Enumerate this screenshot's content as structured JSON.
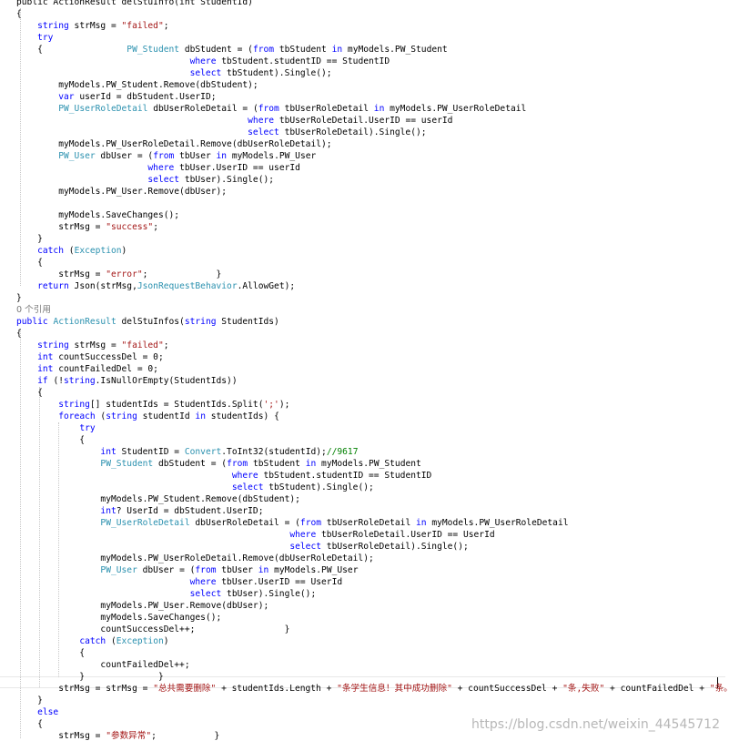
{
  "watermark": "https://blog.csdn.net/weixin_44545712",
  "code_lines": [
    [
      [
        "p",
        "public ActionResult delStuInfo(int StudentId)"
      ]
    ],
    [
      [
        "p",
        "{"
      ]
    ],
    [
      [
        "p",
        "    "
      ],
      [
        "kw",
        "string"
      ],
      [
        "p",
        " strMsg = "
      ],
      [
        "st",
        "\"failed\""
      ],
      [
        "p",
        ";"
      ]
    ],
    [
      [
        "p",
        "    "
      ],
      [
        "kw",
        "try"
      ]
    ],
    [
      [
        "p",
        "    {                "
      ],
      [
        "ty",
        "PW_Student"
      ],
      [
        "p",
        " dbStudent = ("
      ],
      [
        "kw",
        "from"
      ],
      [
        "p",
        " tbStudent "
      ],
      [
        "kw",
        "in"
      ],
      [
        "p",
        " myModels.PW_Student"
      ]
    ],
    [
      [
        "p",
        "                                 "
      ],
      [
        "kw",
        "where"
      ],
      [
        "p",
        " tbStudent.studentID == StudentID"
      ]
    ],
    [
      [
        "p",
        "                                 "
      ],
      [
        "kw",
        "select"
      ],
      [
        "p",
        " tbStudent).Single();"
      ]
    ],
    [
      [
        "p",
        "        myModels.PW_Student.Remove(dbStudent);"
      ]
    ],
    [
      [
        "p",
        "        "
      ],
      [
        "kw",
        "var"
      ],
      [
        "p",
        " userId = dbStudent.UserID;"
      ]
    ],
    [
      [
        "p",
        "        "
      ],
      [
        "ty",
        "PW_UserRoleDetail"
      ],
      [
        "p",
        " dbUserRoleDetail = ("
      ],
      [
        "kw",
        "from"
      ],
      [
        "p",
        " tbUserRoleDetail "
      ],
      [
        "kw",
        "in"
      ],
      [
        "p",
        " myModels.PW_UserRoleDetail"
      ]
    ],
    [
      [
        "p",
        "                                            "
      ],
      [
        "kw",
        "where"
      ],
      [
        "p",
        " tbUserRoleDetail.UserID == userId"
      ]
    ],
    [
      [
        "p",
        "                                            "
      ],
      [
        "kw",
        "select"
      ],
      [
        "p",
        " tbUserRoleDetail).Single();"
      ]
    ],
    [
      [
        "p",
        "        myModels.PW_UserRoleDetail.Remove(dbUserRoleDetail);"
      ]
    ],
    [
      [
        "p",
        "        "
      ],
      [
        "ty",
        "PW_User"
      ],
      [
        "p",
        " dbUser = ("
      ],
      [
        "kw",
        "from"
      ],
      [
        "p",
        " tbUser "
      ],
      [
        "kw",
        "in"
      ],
      [
        "p",
        " myModels.PW_User"
      ]
    ],
    [
      [
        "p",
        "                         "
      ],
      [
        "kw",
        "where"
      ],
      [
        "p",
        " tbUser.UserID == userId"
      ]
    ],
    [
      [
        "p",
        "                         "
      ],
      [
        "kw",
        "select"
      ],
      [
        "p",
        " tbUser).Single();"
      ]
    ],
    [
      [
        "p",
        "        myModels.PW_User.Remove(dbUser);"
      ]
    ],
    [
      [
        "p",
        ""
      ]
    ],
    [
      [
        "p",
        "        myModels.SaveChanges();"
      ]
    ],
    [
      [
        "p",
        "        strMsg = "
      ],
      [
        "st",
        "\"success\""
      ],
      [
        "p",
        ";"
      ]
    ],
    [
      [
        "p",
        "    }"
      ]
    ],
    [
      [
        "p",
        "    "
      ],
      [
        "kw",
        "catch"
      ],
      [
        "p",
        " ("
      ],
      [
        "ty",
        "Exception"
      ],
      [
        "p",
        ")"
      ]
    ],
    [
      [
        "p",
        "    {"
      ]
    ],
    [
      [
        "p",
        "        strMsg = "
      ],
      [
        "st",
        "\"error\""
      ],
      [
        "p",
        ";             }"
      ]
    ],
    [
      [
        "p",
        "    "
      ],
      [
        "kw",
        "return"
      ],
      [
        "p",
        " Json(strMsg,"
      ],
      [
        "ty",
        "JsonRequestBehavior"
      ],
      [
        "p",
        ".AllowGet);"
      ]
    ],
    [
      [
        "p",
        "}"
      ]
    ],
    [
      [
        "lens",
        "0 个引用"
      ]
    ],
    [
      [
        "kw",
        "public"
      ],
      [
        "p",
        " "
      ],
      [
        "ty",
        "ActionResult"
      ],
      [
        "p",
        " delStuInfos("
      ],
      [
        "kw",
        "string"
      ],
      [
        "p",
        " StudentIds)"
      ]
    ],
    [
      [
        "p",
        "{"
      ]
    ],
    [
      [
        "p",
        "    "
      ],
      [
        "kw",
        "string"
      ],
      [
        "p",
        " strMsg = "
      ],
      [
        "st",
        "\"failed\""
      ],
      [
        "p",
        ";"
      ]
    ],
    [
      [
        "p",
        "    "
      ],
      [
        "kw",
        "int"
      ],
      [
        "p",
        " countSuccessDel = 0;"
      ]
    ],
    [
      [
        "p",
        "    "
      ],
      [
        "kw",
        "int"
      ],
      [
        "p",
        " countFailedDel = 0;"
      ]
    ],
    [
      [
        "p",
        "    "
      ],
      [
        "kw",
        "if"
      ],
      [
        "p",
        " (!"
      ],
      [
        "kw",
        "string"
      ],
      [
        "p",
        ".IsNullOrEmpty(StudentIds))"
      ]
    ],
    [
      [
        "p",
        "    {"
      ]
    ],
    [
      [
        "p",
        "        "
      ],
      [
        "kw",
        "string"
      ],
      [
        "p",
        "[] studentIds = StudentIds.Split("
      ],
      [
        "st",
        "';'"
      ],
      [
        "p",
        ");"
      ]
    ],
    [
      [
        "p",
        "        "
      ],
      [
        "kw",
        "foreach"
      ],
      [
        "p",
        " ("
      ],
      [
        "kw",
        "string"
      ],
      [
        "p",
        " studentId "
      ],
      [
        "kw",
        "in"
      ],
      [
        "p",
        " studentIds) {"
      ]
    ],
    [
      [
        "p",
        "            "
      ],
      [
        "kw",
        "try"
      ]
    ],
    [
      [
        "p",
        "            {"
      ]
    ],
    [
      [
        "p",
        "                "
      ],
      [
        "kw",
        "int"
      ],
      [
        "p",
        " StudentID = "
      ],
      [
        "ty",
        "Convert"
      ],
      [
        "p",
        ".ToInt32(studentId);"
      ],
      [
        "cm",
        "//9617"
      ]
    ],
    [
      [
        "p",
        "                "
      ],
      [
        "ty",
        "PW_Student"
      ],
      [
        "p",
        " dbStudent = ("
      ],
      [
        "kw",
        "from"
      ],
      [
        "p",
        " tbStudent "
      ],
      [
        "kw",
        "in"
      ],
      [
        "p",
        " myModels.PW_Student"
      ]
    ],
    [
      [
        "p",
        "                                         "
      ],
      [
        "kw",
        "where"
      ],
      [
        "p",
        " tbStudent.studentID == StudentID"
      ]
    ],
    [
      [
        "p",
        "                                         "
      ],
      [
        "kw",
        "select"
      ],
      [
        "p",
        " tbStudent).Single();"
      ]
    ],
    [
      [
        "p",
        "                myModels.PW_Student.Remove(dbStudent);"
      ]
    ],
    [
      [
        "p",
        "                "
      ],
      [
        "kw",
        "int"
      ],
      [
        "p",
        "? UserId = dbStudent.UserID;"
      ]
    ],
    [
      [
        "p",
        "                "
      ],
      [
        "ty",
        "PW_UserRoleDetail"
      ],
      [
        "p",
        " dbUserRoleDetail = ("
      ],
      [
        "kw",
        "from"
      ],
      [
        "p",
        " tbUserRoleDetail "
      ],
      [
        "kw",
        "in"
      ],
      [
        "p",
        " myModels.PW_UserRoleDetail"
      ]
    ],
    [
      [
        "p",
        "                                                    "
      ],
      [
        "kw",
        "where"
      ],
      [
        "p",
        " tbUserRoleDetail.UserID == UserId"
      ]
    ],
    [
      [
        "p",
        "                                                    "
      ],
      [
        "kw",
        "select"
      ],
      [
        "p",
        " tbUserRoleDetail).Single();"
      ]
    ],
    [
      [
        "p",
        "                myModels.PW_UserRoleDetail.Remove(dbUserRoleDetail);"
      ]
    ],
    [
      [
        "p",
        "                "
      ],
      [
        "ty",
        "PW_User"
      ],
      [
        "p",
        " dbUser = ("
      ],
      [
        "kw",
        "from"
      ],
      [
        "p",
        " tbUser "
      ],
      [
        "kw",
        "in"
      ],
      [
        "p",
        " myModels.PW_User"
      ]
    ],
    [
      [
        "p",
        "                                 "
      ],
      [
        "kw",
        "where"
      ],
      [
        "p",
        " tbUser.UserID == UserId"
      ]
    ],
    [
      [
        "p",
        "                                 "
      ],
      [
        "kw",
        "select"
      ],
      [
        "p",
        " tbUser).Single();"
      ]
    ],
    [
      [
        "p",
        "                myModels.PW_User.Remove(dbUser);"
      ]
    ],
    [
      [
        "p",
        "                myModels.SaveChanges();"
      ]
    ],
    [
      [
        "p",
        "                countSuccessDel++;                 }"
      ]
    ],
    [
      [
        "p",
        "            "
      ],
      [
        "kw",
        "catch"
      ],
      [
        "p",
        " ("
      ],
      [
        "ty",
        "Exception"
      ],
      [
        "p",
        ")"
      ]
    ],
    [
      [
        "p",
        "            {"
      ]
    ],
    [
      [
        "p",
        "                countFailedDel++;"
      ]
    ],
    [
      [
        "p",
        "            }              }"
      ]
    ],
    [
      [
        "p",
        "        strMsg = strMsg = "
      ],
      [
        "st",
        "\"总共需要删除\""
      ],
      [
        "p",
        " + studentIds.Length + "
      ],
      [
        "st",
        "\"条学生信息！其中成功删除\""
      ],
      [
        "p",
        " + countSuccessDel + "
      ],
      [
        "st",
        "\"条,失败\""
      ],
      [
        "p",
        " + countFailedDel + "
      ],
      [
        "st",
        "\"条。\""
      ],
      [
        "p",
        ";"
      ]
    ],
    [
      [
        "p",
        "    }"
      ]
    ],
    [
      [
        "p",
        "    "
      ],
      [
        "kw",
        "else"
      ]
    ],
    [
      [
        "p",
        "    {"
      ]
    ],
    [
      [
        "p",
        "        strMsg = "
      ],
      [
        "st",
        "\"参数异常\""
      ],
      [
        "p",
        ";           }"
      ]
    ],
    [
      [
        "p",
        "    "
      ],
      [
        "kw",
        "return"
      ],
      [
        "p",
        " Json(strMsg,"
      ],
      [
        "ty",
        "JsonRequestBehavior"
      ],
      [
        "p",
        ".AllowGet);"
      ]
    ]
  ]
}
